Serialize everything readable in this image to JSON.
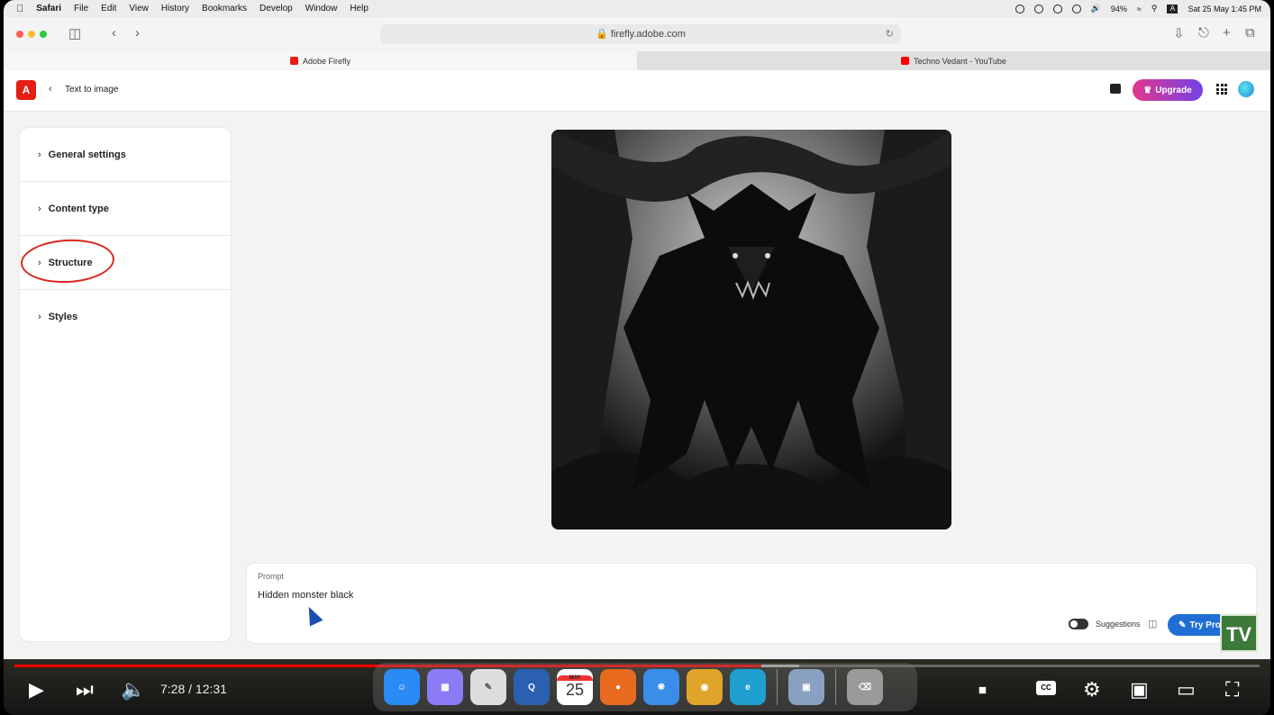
{
  "menubar": {
    "app": "Safari",
    "items": [
      "File",
      "Edit",
      "View",
      "History",
      "Bookmarks",
      "Develop",
      "Window",
      "Help"
    ],
    "battery": "94%",
    "datetime": "Sat 25 May  1:45 PM"
  },
  "browser": {
    "url": "firefly.adobe.com",
    "tabs": [
      {
        "label": "Adobe Firefly",
        "active": true
      },
      {
        "label": "Techno Vedant - YouTube",
        "active": false
      }
    ]
  },
  "app": {
    "breadcrumb": "Text to image",
    "upgrade_label": "Upgrade",
    "accent": "#e41e12",
    "panel_sections": [
      "General settings",
      "Content type",
      "Structure",
      "Styles"
    ],
    "image_subject": "dark monster in forest",
    "prompt": {
      "label": "Prompt",
      "value": "Hidden monster black",
      "suggestions_label": "Suggestions",
      "try_label": "Try Pror"
    }
  },
  "player": {
    "time": "7:28 / 12:31",
    "progress": 0.6,
    "buffered": 0.63,
    "watermark": "TV"
  },
  "dock": {
    "calendar_month": "MAY",
    "calendar_day": "25",
    "apps": [
      "finder-icon",
      "launchpad-icon",
      "notes-icon",
      "quicktime-icon",
      "calendar-icon",
      "firefox-icon",
      "safari-icon",
      "chrome-icon",
      "edge-icon",
      "preview-icon",
      "trash-icon"
    ]
  }
}
